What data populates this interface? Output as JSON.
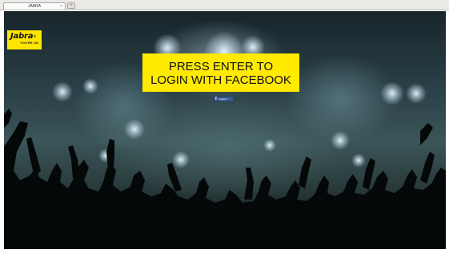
{
  "browser": {
    "tab_title": "JABRA",
    "tab_close": "×",
    "new_tab": "+"
  },
  "logo": {
    "wordmark": "Jabra",
    "registered": "®",
    "tagline": "YOU'RE ON"
  },
  "main": {
    "login_prompt": "PRESS ENTER TO LOGIN WITH FACEBOOK",
    "fb_icon": "f",
    "fb_button_label": "Logga in"
  },
  "colors": {
    "brand_yellow": "#ffea00",
    "facebook_blue": "#3b5c9b"
  },
  "icons": {
    "facebook": "facebook-icon",
    "close": "close-icon",
    "plus": "plus-icon"
  }
}
